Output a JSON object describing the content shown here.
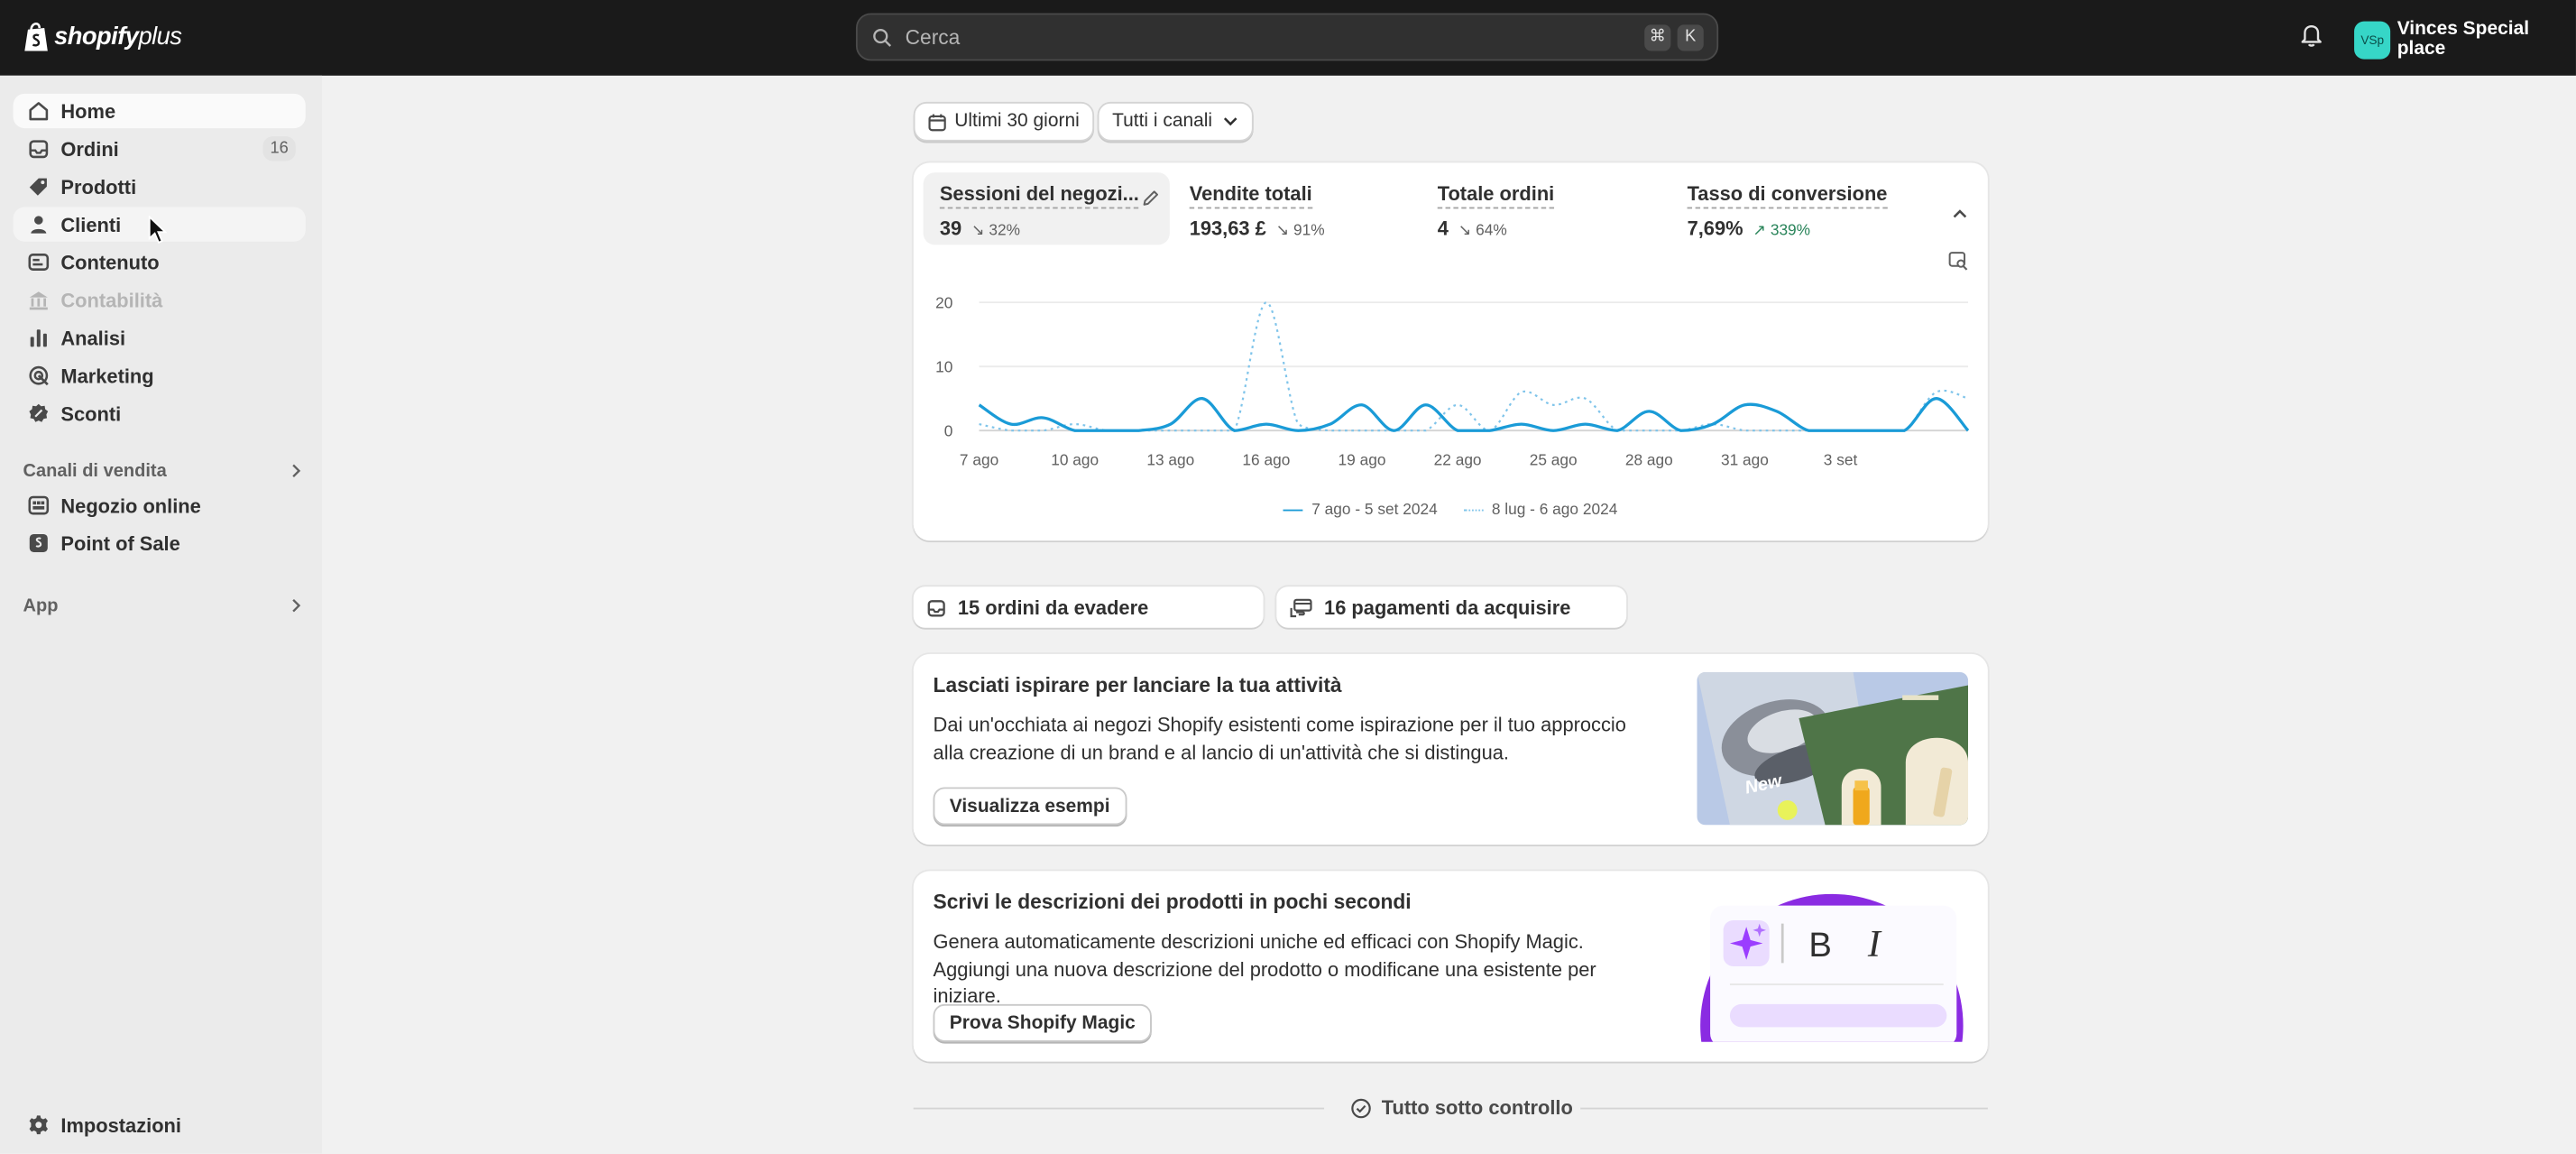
{
  "topbar": {
    "logo_text": "shopify",
    "logo_plus": "plus",
    "search_placeholder": "Cerca",
    "shortcut_cmd": "⌘",
    "shortcut_key": "K",
    "store_initials": "VSp",
    "store_name": "Vinces Special place"
  },
  "sidebar": {
    "items": [
      {
        "label": "Home",
        "icon": "home-icon",
        "state": "active"
      },
      {
        "label": "Ordini",
        "icon": "inbox-icon",
        "badge": "16"
      },
      {
        "label": "Prodotti",
        "icon": "tag-icon"
      },
      {
        "label": "Clienti",
        "icon": "person-icon",
        "state": "hover"
      },
      {
        "label": "Contenuto",
        "icon": "content-icon"
      },
      {
        "label": "Contabilità",
        "icon": "bank-icon",
        "state": "disabled"
      },
      {
        "label": "Analisi",
        "icon": "bar-chart-icon"
      },
      {
        "label": "Marketing",
        "icon": "target-icon"
      },
      {
        "label": "Sconti",
        "icon": "discount-icon"
      }
    ],
    "sales_channels_label": "Canali di vendita",
    "sales_channels": [
      {
        "label": "Negozio online",
        "icon": "store-icon"
      },
      {
        "label": "Point of Sale",
        "icon": "pos-icon"
      }
    ],
    "apps_label": "App",
    "settings_label": "Impostazioni"
  },
  "filters": {
    "date_range": "Ultimi 30 giorni",
    "channels": "Tutti i canali"
  },
  "metrics": [
    {
      "label": "Sessioni del negozi...",
      "value": "39",
      "change": "32%",
      "direction": "down"
    },
    {
      "label": "Vendite totali",
      "value": "193,63 £",
      "change": "91%",
      "direction": "down"
    },
    {
      "label": "Totale ordini",
      "value": "4",
      "change": "64%",
      "direction": "down"
    },
    {
      "label": "Tasso di conversione",
      "value": "7,69%",
      "change": "339%",
      "direction": "up"
    }
  ],
  "chart_data": {
    "type": "line",
    "ylim": [
      0,
      20
    ],
    "yticks": [
      0,
      10,
      20
    ],
    "x_tick_labels": [
      "7 ago",
      "10 ago",
      "13 ago",
      "16 ago",
      "19 ago",
      "22 ago",
      "25 ago",
      "28 ago",
      "31 ago",
      "3 set"
    ],
    "series": [
      {
        "name": "7 ago - 5 set 2024",
        "style": "solid",
        "color": "#1a9bd7",
        "values": [
          4,
          1,
          2,
          0,
          0,
          0,
          1,
          5,
          0,
          1,
          0,
          1,
          4,
          0,
          4,
          0,
          0,
          1,
          0,
          1,
          0,
          3,
          0,
          1,
          4,
          3,
          0,
          0,
          0,
          0,
          5,
          0
        ]
      },
      {
        "name": "8 lug - 6 ago 2024",
        "style": "dotted",
        "color": "#7fc4ea",
        "values": [
          1,
          0,
          0,
          1,
          0,
          0,
          0,
          0,
          0,
          20,
          1,
          0,
          0,
          0,
          0,
          4,
          0,
          6,
          4,
          5,
          0,
          0,
          0,
          1,
          0,
          0,
          0,
          0,
          0,
          0,
          6,
          5
        ]
      }
    ]
  },
  "tasks": [
    {
      "label": "15 ordini da evadere",
      "icon": "inbox-icon"
    },
    {
      "label": "16 pagamenti da acquisire",
      "icon": "payment-icon"
    }
  ],
  "promos": [
    {
      "title": "Lasciati ispirare per lanciare la tua attività",
      "body": "Dai un'occhiata ai negozi Shopify esistenti come ispirazione per il tuo approccio alla creazione di un brand e al lancio di un'attività che si distingua.",
      "button": "Visualizza esempi"
    },
    {
      "title": "Scrivi le descrizioni dei prodotti in pochi secondi",
      "body": "Genera automaticamente descrizioni uniche ed efficaci con Shopify Magic. Aggiungi una nuova descrizione del prodotto o modificane una esistente per iniziare.",
      "button": "Prova Shopify Magic"
    }
  ],
  "footer_status": "Tutto sotto controllo",
  "colors": {
    "topbar": "#1a1a1a",
    "sidebar": "#ebebeb",
    "page": "#f1f1f1",
    "chart_current": "#1a9bd7",
    "chart_previous": "#7fc4ea",
    "positive": "#29845a"
  }
}
